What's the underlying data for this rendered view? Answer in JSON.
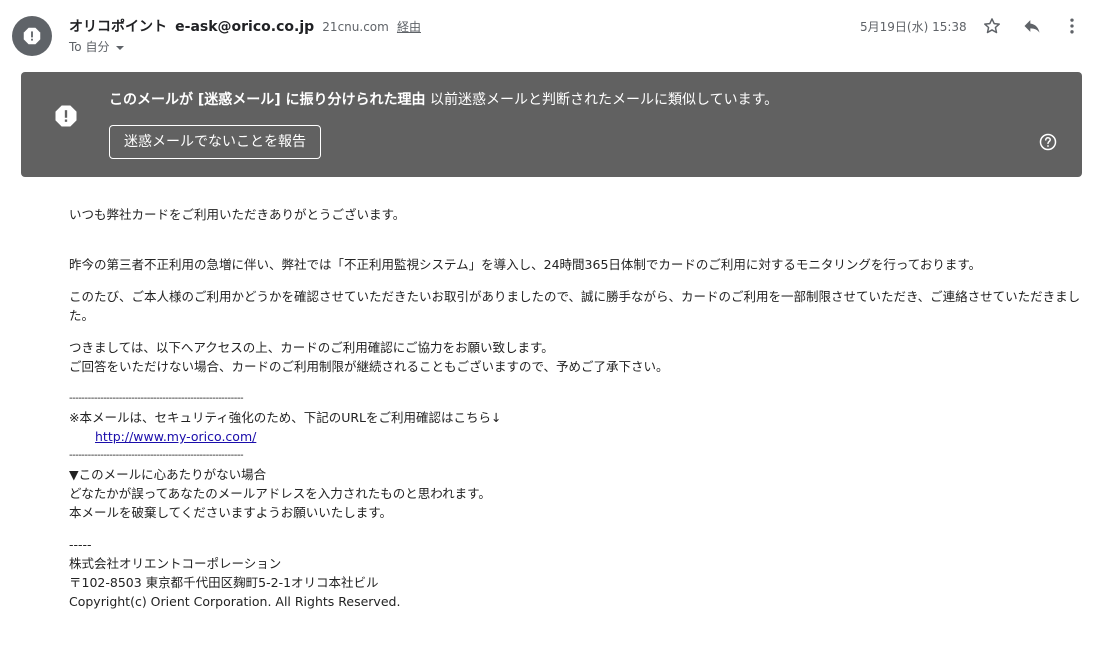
{
  "header": {
    "sender_name": "オリコポイント",
    "sender_email": "e-ask@orico.co.jp",
    "via_domain": "21cnu.com",
    "via_label": "経由",
    "to_label": "To 自分",
    "date": "5月19日(水) 15:38"
  },
  "icons": {
    "avatar": "alert-icon",
    "star": "star-icon",
    "reply": "reply-icon",
    "more": "more-vert-icon",
    "help": "help-icon"
  },
  "spam_banner": {
    "reason_bold": "このメールが [迷惑メール] に振り分けられた理由",
    "reason_text": "以前迷惑メールと判断されたメールに類似しています。",
    "report_button": "迷惑メールでないことを報告"
  },
  "body": {
    "greeting": "いつも弊社カードをご利用いただきありがとうございます。",
    "para1": "昨今の第三者不正利用の急増に伴い、弊社では「不正利用監視システム」を導入し、24時間365日体制でカードのご利用に対するモニタリングを行っております。",
    "para2": "このたび、ご本人様のご利用かどうかを確認させていただきたいお取引がありましたので、誠に勝手ながら、カードのご利用を一部制限させていただき、ご連絡させていただきました。",
    "para3_line1": "つきましては、以下へアクセスの上、カードのご利用確認にご協力をお願い致します。",
    "para3_line2": "ご回答をいただけない場合、カードのご利用制限が継続されることもございますので、予めご了承下さい。",
    "divider": "--------------------------------------------------------",
    "notice": "※本メールは、セキュリティ強化のため、下記のURLをご利用確認はこちら↓",
    "link": "http://www.my-orico.com/",
    "nocontact_title": "▼このメールに心あたりがない場合",
    "nocontact_line1": "どなたかが誤ってあなたのメールアドレスを入力されたものと思われます。",
    "nocontact_line2": "本メールを破棄してくださいますようお願いいたします。",
    "sig_sep": "-----",
    "company": "株式会社オリエントコーポレーション",
    "address": "〒102-8503 東京都千代田区麹町5-2-1オリコ本社ビル",
    "copyright": "Copyright(c) Orient Corporation. All Rights Reserved."
  },
  "colors": {
    "banner_bg": "#616161",
    "avatar_bg": "#5f6368",
    "link": "#1a0dab"
  }
}
